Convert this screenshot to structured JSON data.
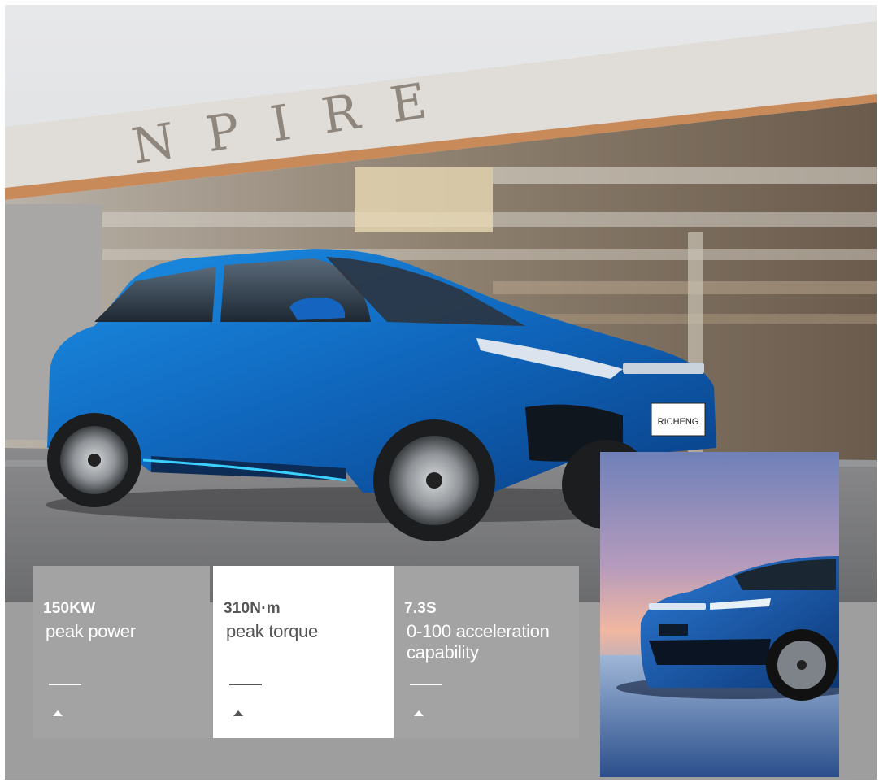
{
  "hero": {
    "background_words": "NPIRE",
    "plate_text": "RICHENG"
  },
  "stats": [
    {
      "value": "150KW",
      "label": "peak power"
    },
    {
      "value": "310N·m",
      "label": "peak torque"
    },
    {
      "value": "7.3S",
      "label": "0-100 acceleration capability"
    }
  ],
  "colors": {
    "car_blue": "#1a73c8",
    "band_grey": "#9e9e9e",
    "highlight_card": "#ffffff"
  },
  "icons": [
    "dash-line",
    "triangle-up-icon"
  ]
}
